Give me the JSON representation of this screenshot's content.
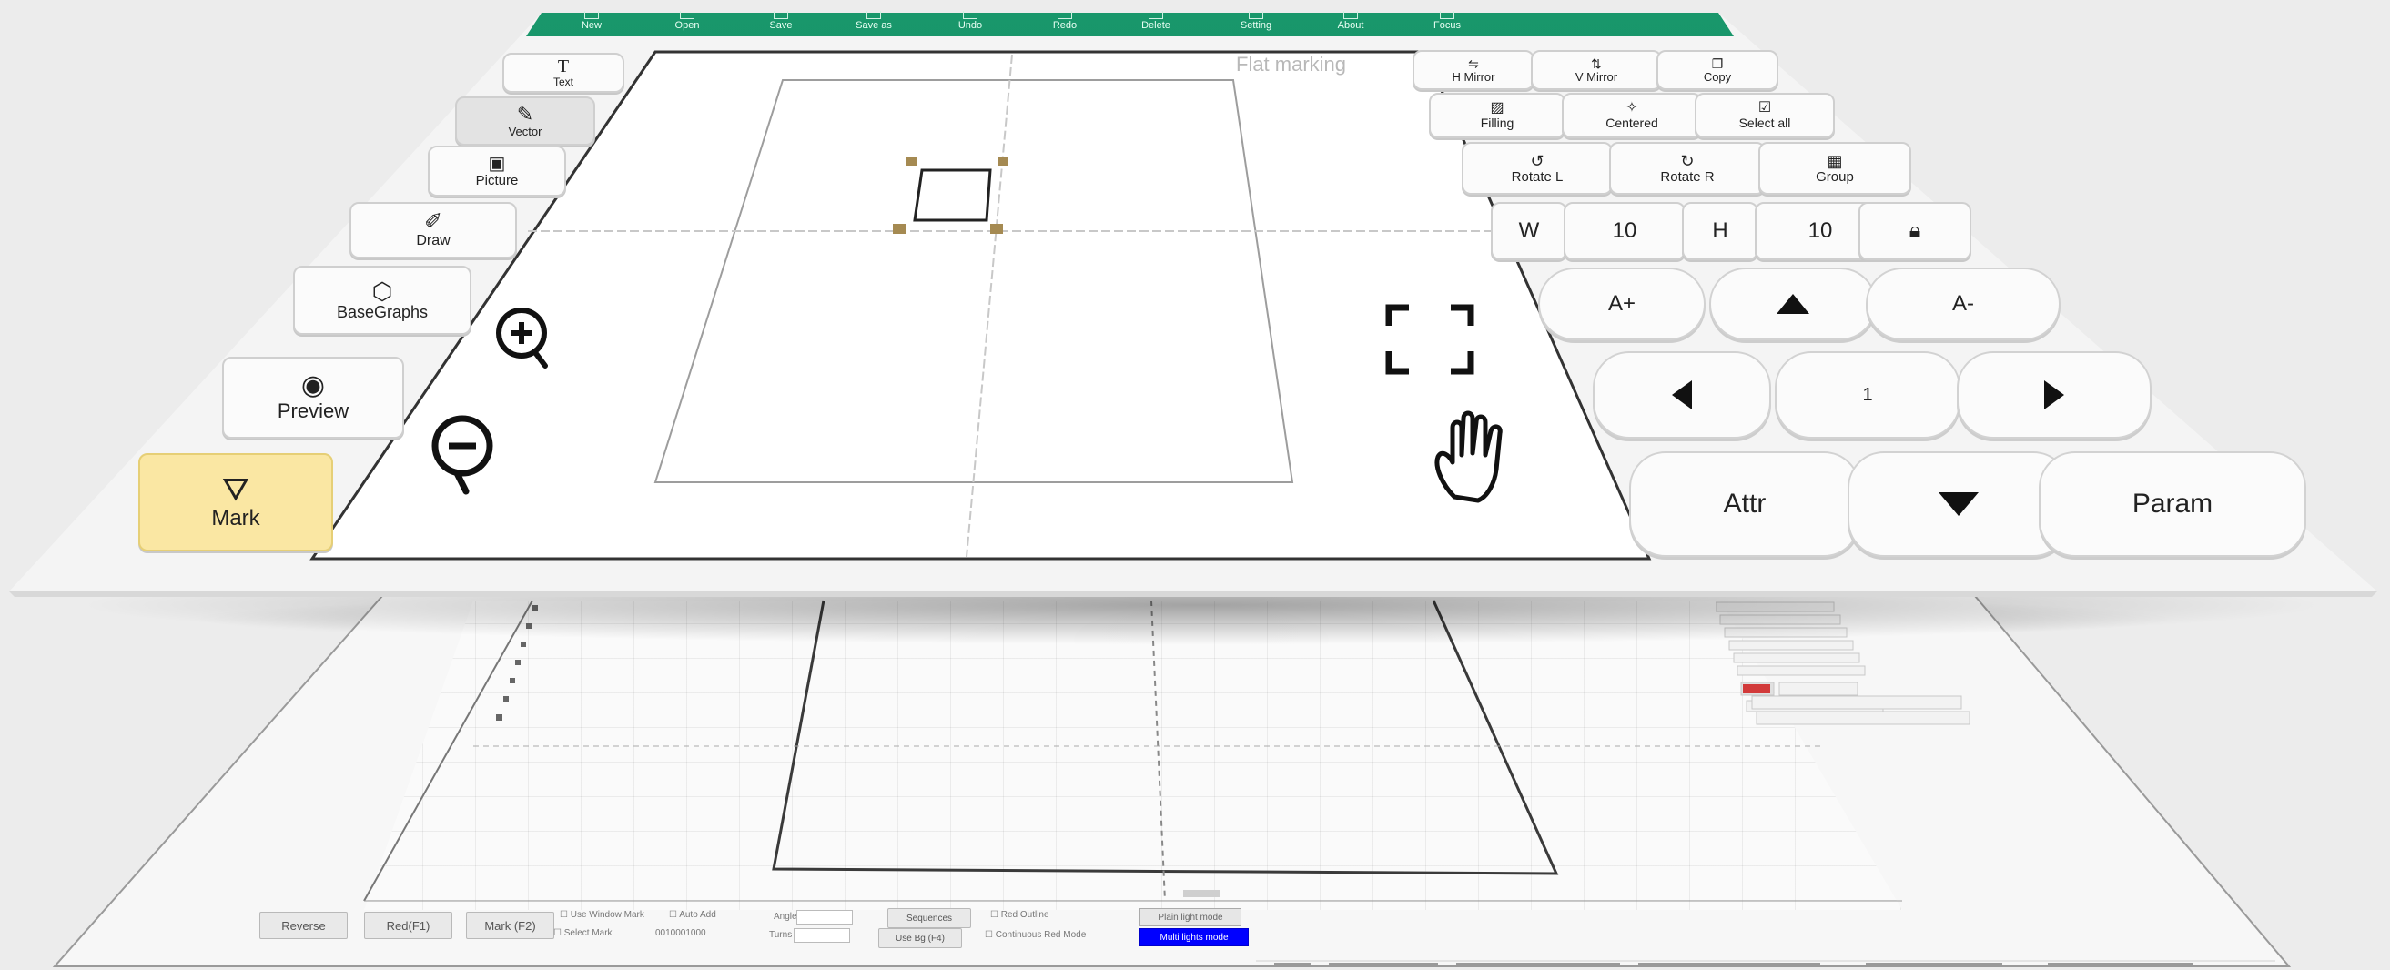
{
  "toolbar": {
    "items": [
      {
        "label": "New",
        "icon": "new-file-icon"
      },
      {
        "label": "Open",
        "icon": "open-folder-icon"
      },
      {
        "label": "Save",
        "icon": "save-icon"
      },
      {
        "label": "Save as",
        "icon": "save-as-icon"
      },
      {
        "label": "Undo",
        "icon": "undo-icon"
      },
      {
        "label": "Redo",
        "icon": "redo-icon"
      },
      {
        "label": "Delete",
        "icon": "delete-icon"
      },
      {
        "label": "Setting",
        "icon": "setting-icon"
      },
      {
        "label": "About",
        "icon": "about-icon"
      },
      {
        "label": "Focus",
        "icon": "focus-icon"
      }
    ]
  },
  "left_panel": {
    "text": "Text",
    "vector": "Vector",
    "picture": "Picture",
    "draw": "Draw",
    "basegraphs": "BaseGraphs",
    "preview": "Preview",
    "mark": "Mark"
  },
  "canvas": {
    "mode_label": "Flat marking"
  },
  "right_panel": {
    "h_mirror": "H Mirror",
    "v_mirror": "V Mirror",
    "copy": "Copy",
    "filling": "Filling",
    "centered": "Centered",
    "select_all": "Select all",
    "rotate_l": "Rotate L",
    "rotate_r": "Rotate R",
    "group": "Group",
    "w_label": "W",
    "w_value": "10",
    "h_label": "H",
    "h_value": "10",
    "a_plus": "A+",
    "a_minus": "A-",
    "step_value": "1",
    "attr": "Attr",
    "param": "Param"
  },
  "back_window": {
    "bottom_buttons": [
      "Reverse",
      "Red(F1)",
      "Mark (F2)"
    ],
    "checks": [
      "Use Window Mark",
      "Auto Add",
      "Select Mark"
    ],
    "serial": "0010001000",
    "angle_label": "Angle",
    "turns_label": "Turns",
    "buttons2": [
      "Sequences",
      "Use Bg (F4)"
    ],
    "checks2": [
      "Red Outline",
      "Continuous Red Mode"
    ],
    "mode_buttons": [
      "Plain light mode",
      "Multi lights mode"
    ],
    "colors": {
      "mode_active": "#0000ff",
      "mode_inactive": "#e6e6e6"
    }
  },
  "colors": {
    "toolbar": "#13936a",
    "mark_button": "#fae7a3",
    "canvas_bg": "#ffffff"
  }
}
